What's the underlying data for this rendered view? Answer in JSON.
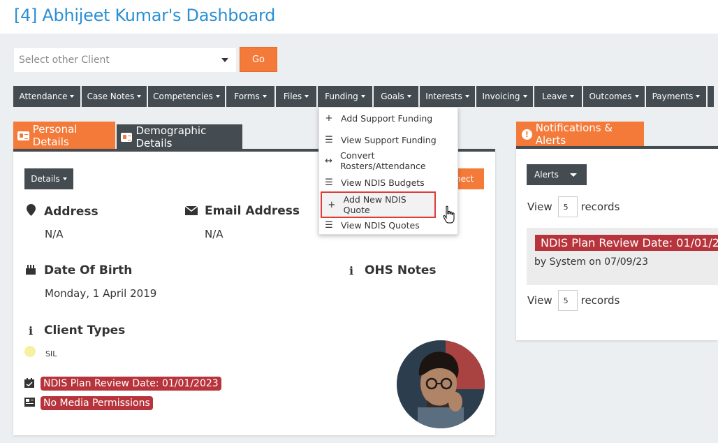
{
  "header": {
    "title": "[4] Abhijeet Kumar's Dashboard"
  },
  "client_select": {
    "placeholder": "Select other Client",
    "go_label": "Go"
  },
  "menu": [
    "Attendance",
    "Case Notes",
    "Competencies",
    "Forms",
    "Files",
    "Funding",
    "Goals",
    "Interests",
    "Invoicing",
    "Leave",
    "Outcomes",
    "Payments"
  ],
  "funding_dropdown": [
    {
      "icon": "plus-icon",
      "label": "Add Support Funding"
    },
    {
      "icon": "list-icon",
      "label": "View Support Funding"
    },
    {
      "icon": "arrows-horizontal-icon",
      "label": "Convert Rosters/Attendance"
    },
    {
      "icon": "list-icon",
      "label": "View NDIS Budgets"
    },
    {
      "icon": "plus-icon",
      "label": "Add New NDIS Quote"
    },
    {
      "icon": "list-icon",
      "label": "View NDIS Quotes"
    }
  ],
  "tabs": {
    "personal": "Personal Details",
    "demographic": "Demographic Details"
  },
  "details": {
    "details_btn": "Details",
    "connect_btn": "nect",
    "address_label": "Address",
    "address_value": "N/A",
    "email_label": "Email Address",
    "email_value": "N/A",
    "dob_label": "Date Of Birth",
    "dob_value": "Monday, 1 April 2019",
    "ohs_label": "OHS Notes",
    "client_types_label": "Client Types",
    "client_type": "SIL",
    "plan_review_badge": "NDIS Plan Review Date: 01/01/2023",
    "media_badge": "No Media Permissions"
  },
  "notifications": {
    "tab": "Notifications & Alerts",
    "alerts_btn": "Alerts",
    "view": "View",
    "records_count": "5",
    "records": "records",
    "notice_title": "NDIS Plan Review Date: 01/01/2",
    "notice_by": "by System on 07/09/23"
  },
  "colors": {
    "accent": "#f47a3a",
    "dark": "#444c52",
    "link_title": "#2a8fd4",
    "badge": "#b8343c"
  }
}
